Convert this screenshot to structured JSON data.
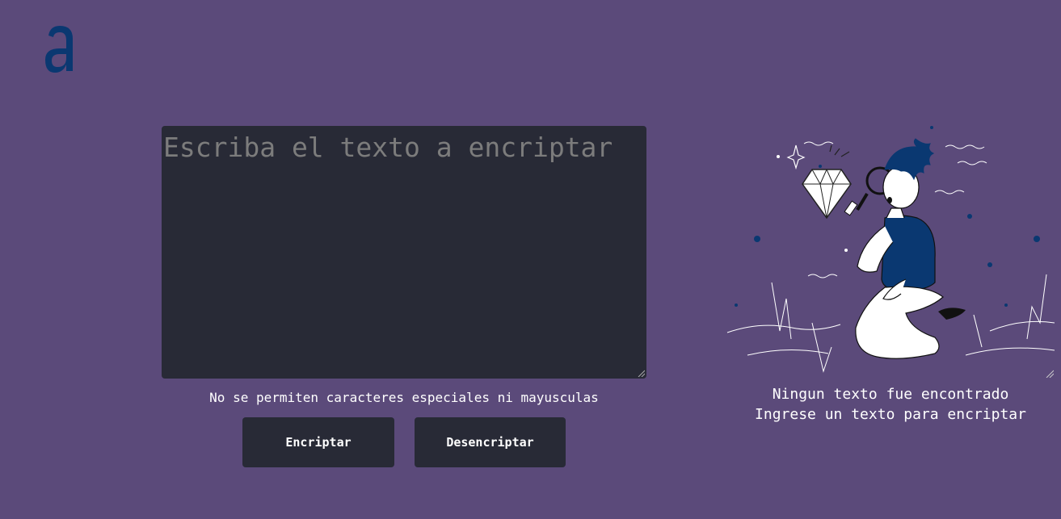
{
  "logo": {
    "icon": "alura-a-logo-icon",
    "color": "#0a3871"
  },
  "input": {
    "placeholder": "Escriba el texto a encriptar"
  },
  "warning": {
    "text": "No se permiten caracteres especiales ni mayusculas"
  },
  "buttons": {
    "encrypt_label": "Encriptar",
    "decrypt_label": "Desencriptar"
  },
  "output": {
    "illustration_icon": "person-with-magnifier-illustration",
    "title": "Ningun texto fue encontrado",
    "subtitle": "Ingrese un texto para encriptar"
  },
  "colors": {
    "background": "#5b4a7a",
    "panel": "#282a36",
    "accent": "#0a3871",
    "text": "#ffffff"
  }
}
